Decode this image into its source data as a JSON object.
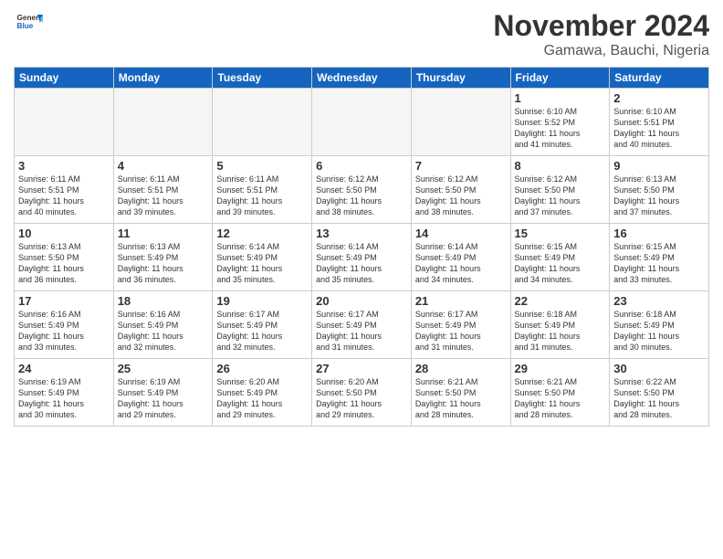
{
  "header": {
    "logo_general": "General",
    "logo_blue": "Blue",
    "month_title": "November 2024",
    "location": "Gamawa, Bauchi, Nigeria"
  },
  "days_of_week": [
    "Sunday",
    "Monday",
    "Tuesday",
    "Wednesday",
    "Thursday",
    "Friday",
    "Saturday"
  ],
  "weeks": [
    [
      {
        "day": "",
        "empty": true,
        "text": ""
      },
      {
        "day": "",
        "empty": true,
        "text": ""
      },
      {
        "day": "",
        "empty": true,
        "text": ""
      },
      {
        "day": "",
        "empty": true,
        "text": ""
      },
      {
        "day": "",
        "empty": true,
        "text": ""
      },
      {
        "day": "1",
        "text": "Sunrise: 6:10 AM\nSunset: 5:52 PM\nDaylight: 11 hours\nand 41 minutes."
      },
      {
        "day": "2",
        "text": "Sunrise: 6:10 AM\nSunset: 5:51 PM\nDaylight: 11 hours\nand 40 minutes."
      }
    ],
    [
      {
        "day": "3",
        "text": "Sunrise: 6:11 AM\nSunset: 5:51 PM\nDaylight: 11 hours\nand 40 minutes."
      },
      {
        "day": "4",
        "text": "Sunrise: 6:11 AM\nSunset: 5:51 PM\nDaylight: 11 hours\nand 39 minutes."
      },
      {
        "day": "5",
        "text": "Sunrise: 6:11 AM\nSunset: 5:51 PM\nDaylight: 11 hours\nand 39 minutes."
      },
      {
        "day": "6",
        "text": "Sunrise: 6:12 AM\nSunset: 5:50 PM\nDaylight: 11 hours\nand 38 minutes."
      },
      {
        "day": "7",
        "text": "Sunrise: 6:12 AM\nSunset: 5:50 PM\nDaylight: 11 hours\nand 38 minutes."
      },
      {
        "day": "8",
        "text": "Sunrise: 6:12 AM\nSunset: 5:50 PM\nDaylight: 11 hours\nand 37 minutes."
      },
      {
        "day": "9",
        "text": "Sunrise: 6:13 AM\nSunset: 5:50 PM\nDaylight: 11 hours\nand 37 minutes."
      }
    ],
    [
      {
        "day": "10",
        "text": "Sunrise: 6:13 AM\nSunset: 5:50 PM\nDaylight: 11 hours\nand 36 minutes."
      },
      {
        "day": "11",
        "text": "Sunrise: 6:13 AM\nSunset: 5:49 PM\nDaylight: 11 hours\nand 36 minutes."
      },
      {
        "day": "12",
        "text": "Sunrise: 6:14 AM\nSunset: 5:49 PM\nDaylight: 11 hours\nand 35 minutes."
      },
      {
        "day": "13",
        "text": "Sunrise: 6:14 AM\nSunset: 5:49 PM\nDaylight: 11 hours\nand 35 minutes."
      },
      {
        "day": "14",
        "text": "Sunrise: 6:14 AM\nSunset: 5:49 PM\nDaylight: 11 hours\nand 34 minutes."
      },
      {
        "day": "15",
        "text": "Sunrise: 6:15 AM\nSunset: 5:49 PM\nDaylight: 11 hours\nand 34 minutes."
      },
      {
        "day": "16",
        "text": "Sunrise: 6:15 AM\nSunset: 5:49 PM\nDaylight: 11 hours\nand 33 minutes."
      }
    ],
    [
      {
        "day": "17",
        "text": "Sunrise: 6:16 AM\nSunset: 5:49 PM\nDaylight: 11 hours\nand 33 minutes."
      },
      {
        "day": "18",
        "text": "Sunrise: 6:16 AM\nSunset: 5:49 PM\nDaylight: 11 hours\nand 32 minutes."
      },
      {
        "day": "19",
        "text": "Sunrise: 6:17 AM\nSunset: 5:49 PM\nDaylight: 11 hours\nand 32 minutes."
      },
      {
        "day": "20",
        "text": "Sunrise: 6:17 AM\nSunset: 5:49 PM\nDaylight: 11 hours\nand 31 minutes."
      },
      {
        "day": "21",
        "text": "Sunrise: 6:17 AM\nSunset: 5:49 PM\nDaylight: 11 hours\nand 31 minutes."
      },
      {
        "day": "22",
        "text": "Sunrise: 6:18 AM\nSunset: 5:49 PM\nDaylight: 11 hours\nand 31 minutes."
      },
      {
        "day": "23",
        "text": "Sunrise: 6:18 AM\nSunset: 5:49 PM\nDaylight: 11 hours\nand 30 minutes."
      }
    ],
    [
      {
        "day": "24",
        "text": "Sunrise: 6:19 AM\nSunset: 5:49 PM\nDaylight: 11 hours\nand 30 minutes."
      },
      {
        "day": "25",
        "text": "Sunrise: 6:19 AM\nSunset: 5:49 PM\nDaylight: 11 hours\nand 29 minutes."
      },
      {
        "day": "26",
        "text": "Sunrise: 6:20 AM\nSunset: 5:49 PM\nDaylight: 11 hours\nand 29 minutes."
      },
      {
        "day": "27",
        "text": "Sunrise: 6:20 AM\nSunset: 5:50 PM\nDaylight: 11 hours\nand 29 minutes."
      },
      {
        "day": "28",
        "text": "Sunrise: 6:21 AM\nSunset: 5:50 PM\nDaylight: 11 hours\nand 28 minutes."
      },
      {
        "day": "29",
        "text": "Sunrise: 6:21 AM\nSunset: 5:50 PM\nDaylight: 11 hours\nand 28 minutes."
      },
      {
        "day": "30",
        "text": "Sunrise: 6:22 AM\nSunset: 5:50 PM\nDaylight: 11 hours\nand 28 minutes."
      }
    ]
  ]
}
